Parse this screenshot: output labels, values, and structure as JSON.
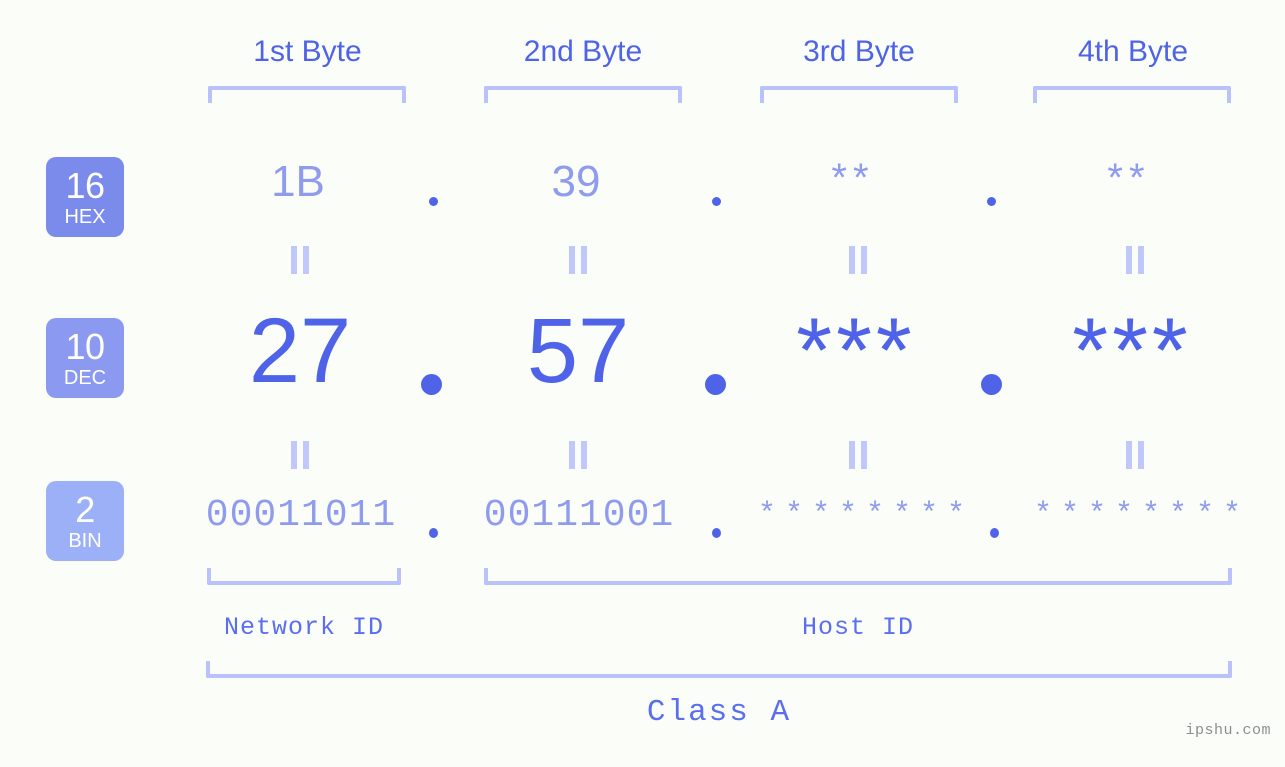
{
  "background": "#fbfdf8",
  "accent_strong": "#4f63e8",
  "accent_mid": "#8f9cee",
  "accent_light": "#b9c2fb",
  "header": {
    "bytes": [
      {
        "label": "1st Byte"
      },
      {
        "label": "2nd Byte"
      },
      {
        "label": "3rd Byte"
      },
      {
        "label": "4th Byte"
      }
    ]
  },
  "notations": [
    {
      "num": "16",
      "base": "HEX",
      "color": "#7a8bec"
    },
    {
      "num": "10",
      "base": "DEC",
      "color": "#8b9af0"
    },
    {
      "num": "2",
      "base": "BIN",
      "color": "#9cb0f7"
    }
  ],
  "rows": {
    "hex": {
      "values": [
        "1B",
        "39",
        "**",
        "**"
      ],
      "separator": "."
    },
    "dec": {
      "values": [
        "27",
        "57",
        "***",
        "***"
      ],
      "separator": "."
    },
    "bin": {
      "values": [
        "00011011",
        "00111001",
        "********",
        "********"
      ],
      "separator": "."
    }
  },
  "equals_symbol": "=",
  "sections": [
    {
      "label": "Network ID"
    },
    {
      "label": "Host ID"
    }
  ],
  "class": {
    "label": "Class A"
  },
  "watermark": {
    "text": "ipshu.com"
  }
}
